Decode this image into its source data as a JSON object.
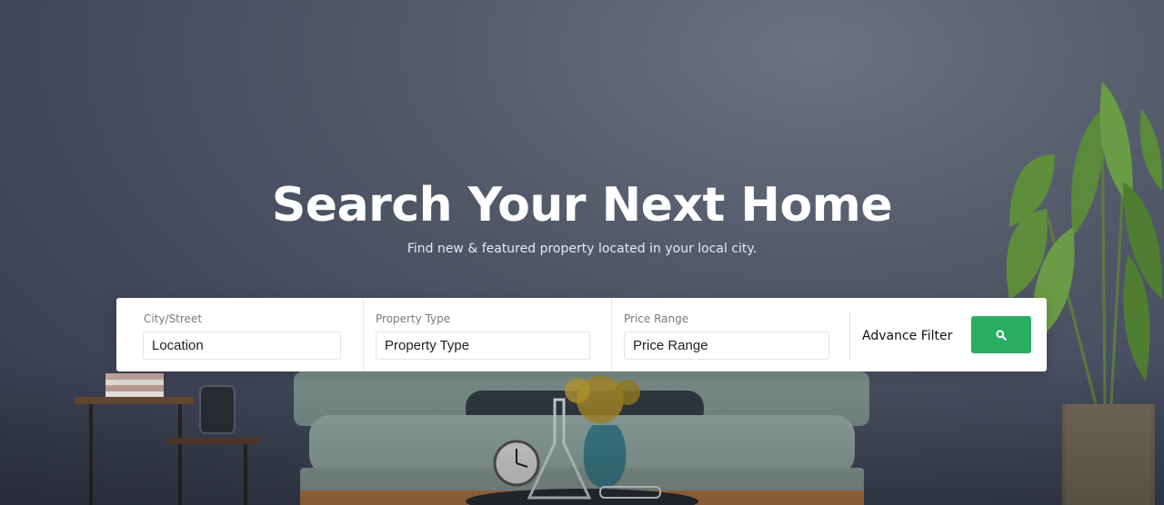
{
  "hero": {
    "title": "Search Your Next Home",
    "subtitle": "Find new & featured property located in your local city."
  },
  "search": {
    "city": {
      "label": "City/Street",
      "value": "Location"
    },
    "property_type": {
      "label": "Property Type",
      "value": "Property Type"
    },
    "price_range": {
      "label": "Price Range",
      "value": "Price Range"
    },
    "advance_filter_label": "Advance Filter",
    "search_button_icon": "search-icon"
  },
  "colors": {
    "accent": "#27ae60",
    "background": "#4a5162",
    "text_light": "#ffffff"
  }
}
